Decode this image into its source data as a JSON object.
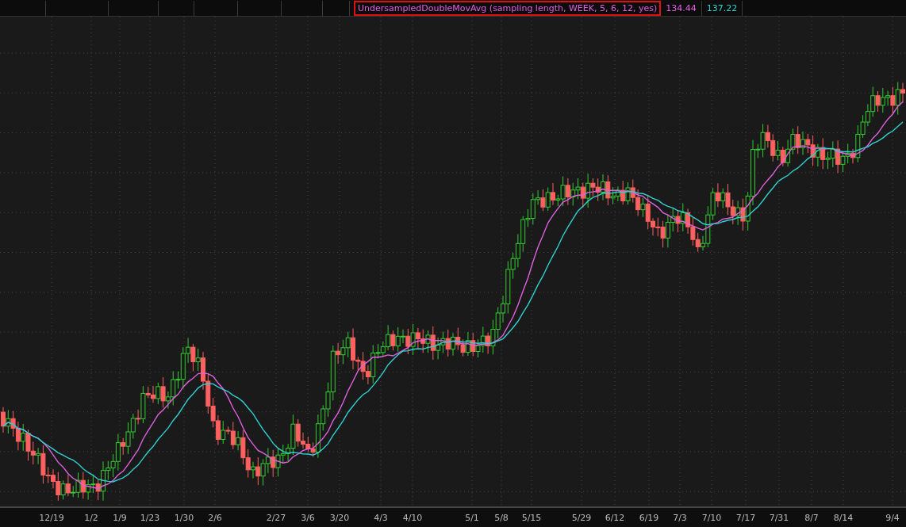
{
  "study_label": "UndersampledDoubleMovAvg (sampling length, WEEK, 5, 6, 12, yes)",
  "readings": [
    {
      "value": "134.44",
      "color": "#e060e0"
    },
    {
      "value": "137.22",
      "color": "#30d0d0"
    }
  ],
  "x_axis_labels": [
    "12/19",
    "1/2",
    "1/9",
    "1/23",
    "1/30",
    "2/6",
    "2/27",
    "3/6",
    "3/20",
    "4/3",
    "4/10",
    "5/1",
    "5/8",
    "5/15",
    "5/29",
    "6/12",
    "6/19",
    "7/3",
    "7/10",
    "7/17",
    "7/31",
    "8/7",
    "8/14",
    "9/4"
  ]
}
